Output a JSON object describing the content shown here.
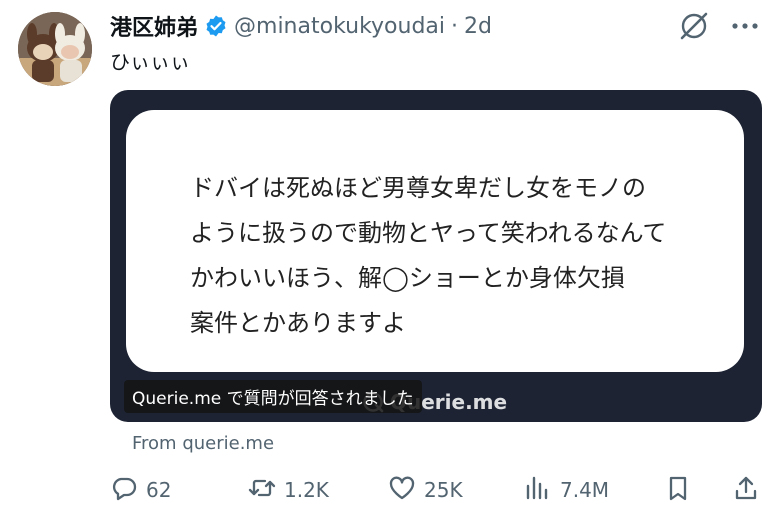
{
  "tweet": {
    "display_name": "港区姉弟",
    "handle": "@minatokukyoudai",
    "separator": "·",
    "time": "2d",
    "text": "ひぃぃぃ"
  },
  "media": {
    "card_lines": [
      "ドバイは死ぬほど男尊女卑だし女をモノの",
      "ように扱うので動物とヤって笑われるなんて",
      "かわいいほう、解◯ショーとか身体欠損",
      "案件とかありますよ"
    ],
    "watermark": "Querie.me",
    "caption": "Querie.me で質問が回答されました"
  },
  "source": "From querie.me",
  "actions": {
    "replies": "62",
    "reposts": "1.2K",
    "likes": "25K",
    "views": "7.4M"
  },
  "colors": {
    "verified": "#1d9bf0",
    "text_secondary": "#536471",
    "media_bg": "#1d2333"
  },
  "icons": [
    "avatar",
    "verified-icon",
    "grok-icon",
    "more-icon",
    "reply-icon",
    "repost-icon",
    "like-icon",
    "views-icon",
    "bookmark-icon",
    "share-icon",
    "querie-logo-icon"
  ]
}
